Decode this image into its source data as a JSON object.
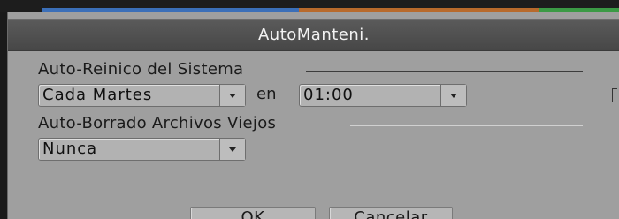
{
  "dialog": {
    "title": "AutoManteni."
  },
  "reboot": {
    "label": "Auto-Reinico del Sistema",
    "day_value": "Cada Martes",
    "connector": "en",
    "time_value": "01:00"
  },
  "delete_files": {
    "label": "Auto-Borrado Archivos Viejos",
    "value": "Nunca"
  },
  "buttons": {
    "ok": "OK",
    "cancel": "Cancelar"
  },
  "icons": {
    "dropdown": "chevron-down-icon"
  },
  "colors": {
    "dialog_bg": "#9f9f9f",
    "titlebar_bg": "#4f4f4f",
    "accent_blue": "#3b6fb8",
    "accent_orange": "#b86a2c",
    "accent_green": "#3b9a45"
  }
}
